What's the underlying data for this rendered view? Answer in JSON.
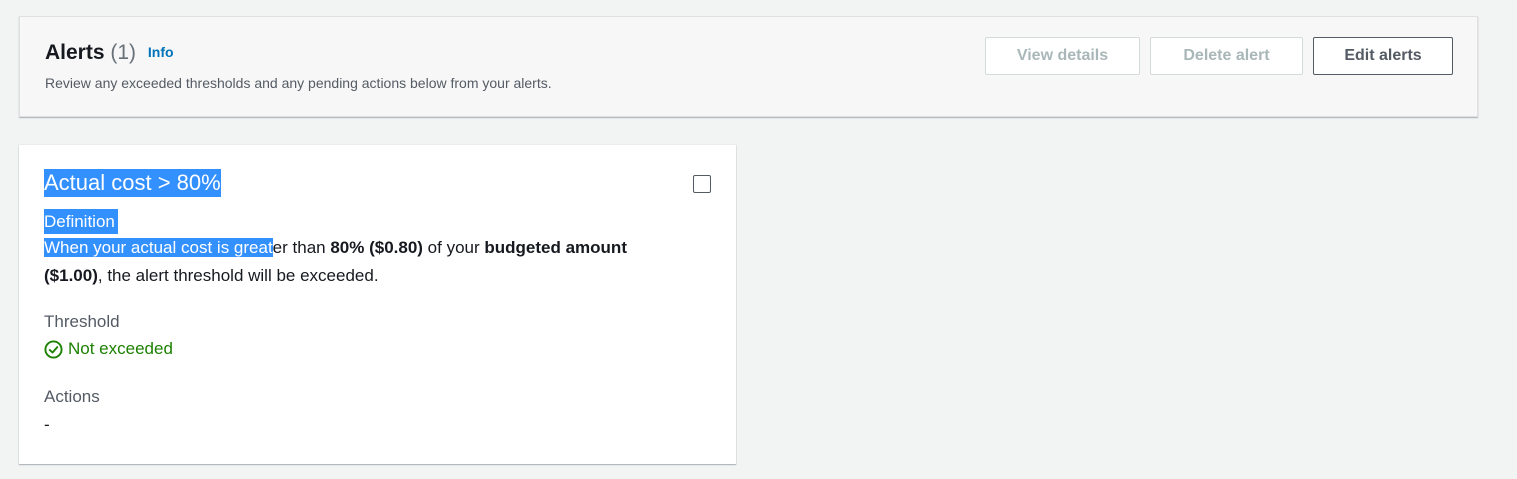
{
  "header": {
    "title": "Alerts",
    "count": "(1)",
    "info": "Info",
    "description": "Review any exceeded thresholds and any pending actions below from your alerts.",
    "buttons": {
      "view_details": "View details",
      "delete_alert": "Delete alert",
      "edit_alerts": "Edit alerts"
    }
  },
  "alert_card": {
    "title": "Actual cost > 80%",
    "definition_label": "Definition",
    "definition": {
      "part1_selected": "When your actual cost is great",
      "part2": "er than ",
      "part3_bold": "80% ($0.80)",
      "part4": " of your ",
      "part5_bold": "budgeted amount ($1.00)",
      "part6": ", the alert threshold will be exceeded."
    },
    "threshold_label": "Threshold",
    "threshold_status": "Not exceeded",
    "actions_label": "Actions",
    "actions_value": "-"
  },
  "colors": {
    "success": "#1d8102",
    "selection": "#3390ff",
    "link": "#0073bb"
  },
  "icons": {
    "status": "check-circle-icon"
  }
}
